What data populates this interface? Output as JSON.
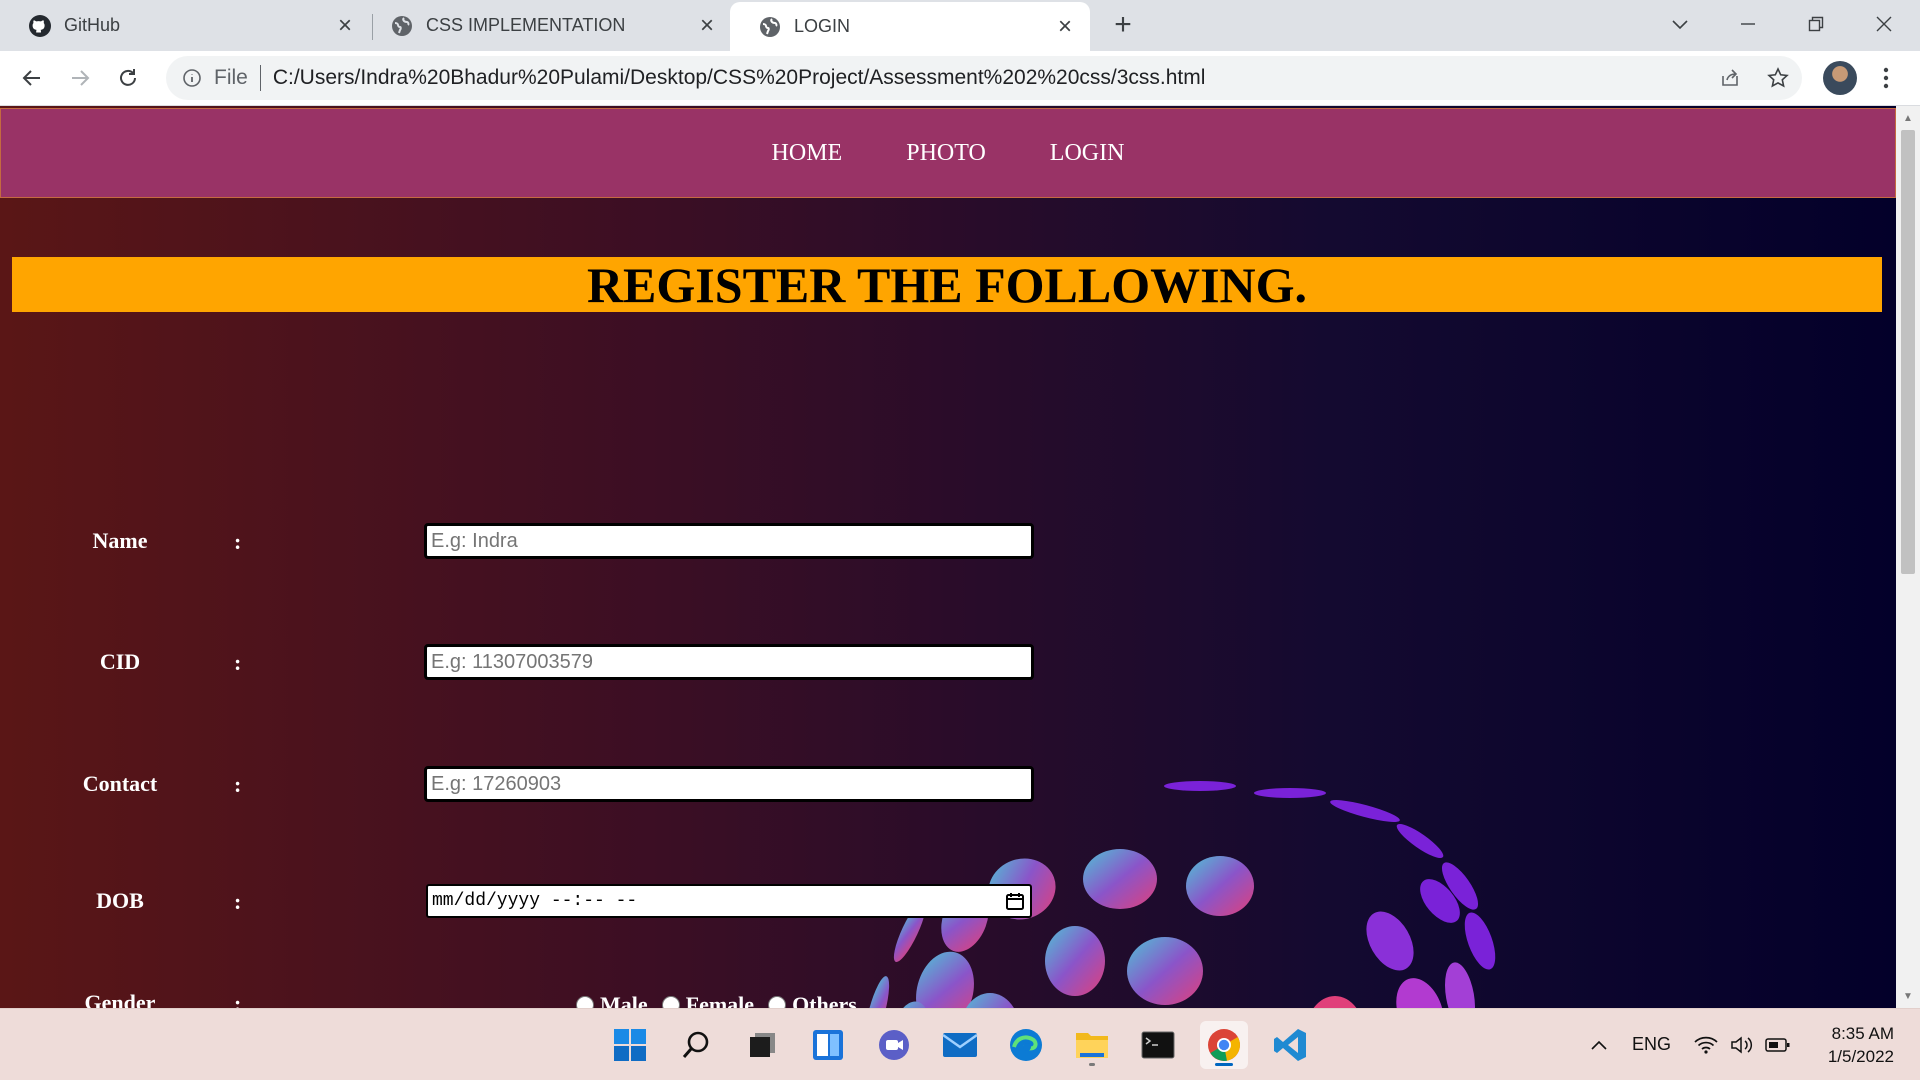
{
  "browser": {
    "tabs": [
      {
        "title": "GitHub",
        "icon": "github-icon",
        "active": false
      },
      {
        "title": "CSS IMPLEMENTATION",
        "icon": "globe-icon",
        "active": false
      },
      {
        "title": "LOGIN",
        "icon": "globe-icon",
        "active": true
      }
    ],
    "address": {
      "scheme_label": "File",
      "url": "C:/Users/Indra%20Bhadur%20Pulami/Desktop/CSS%20Project/Assessment%202%20css/3css.html"
    }
  },
  "page": {
    "nav": [
      "HOME",
      "PHOTO",
      "LOGIN"
    ],
    "banner_title": "REGISTER THE FOLLOWING.",
    "colon": ":",
    "form": {
      "name": {
        "label": "Name",
        "placeholder": "E.g: Indra"
      },
      "cid": {
        "label": "CID",
        "placeholder": "E.g: 11307003579"
      },
      "contact": {
        "label": "Contact",
        "placeholder": "E.g: 17260903"
      },
      "dob": {
        "label": "DOB",
        "value_text": "mm/dd/yyyy --:-- --"
      },
      "gender": {
        "label": "Gender",
        "options": [
          "Male",
          "Female",
          "Others"
        ]
      }
    },
    "colors": {
      "navbar": "#993366",
      "banner": "#ffa500",
      "background_left": "#5a1616",
      "background_right": "#03002a"
    }
  },
  "taskbar": {
    "apps": [
      "windows-start-icon",
      "search-icon",
      "task-view-icon",
      "widgets-icon",
      "teams-chat-icon",
      "mail-icon",
      "edge-icon",
      "file-explorer-icon",
      "terminal-icon",
      "chrome-icon",
      "vscode-icon"
    ],
    "language": "ENG",
    "time": "8:35 AM",
    "date": "1/5/2022"
  }
}
